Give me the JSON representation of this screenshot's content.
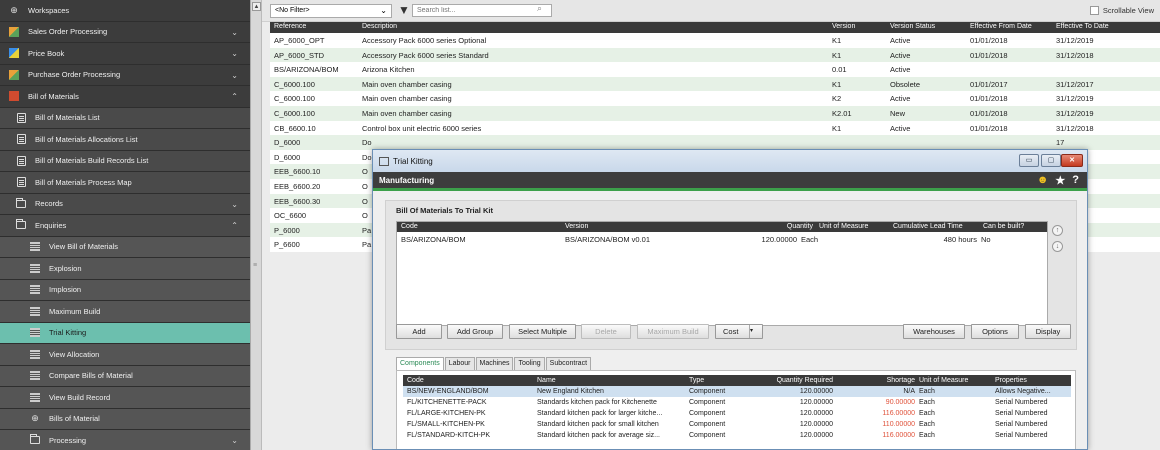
{
  "sidebar": {
    "items": [
      {
        "label": "Workspaces",
        "icon": "globe-icon",
        "level": 0,
        "chevron": ""
      },
      {
        "label": "Sales Order Processing",
        "icon": "sales-order-icon",
        "level": 0,
        "chevron": "⌄"
      },
      {
        "label": "Price Book",
        "icon": "price-book-icon",
        "level": 0,
        "chevron": "⌄"
      },
      {
        "label": "Purchase Order Processing",
        "icon": "purchase-order-icon",
        "level": 0,
        "chevron": "⌄"
      },
      {
        "label": "Bill of Materials",
        "icon": "bill-of-materials-icon",
        "level": 0,
        "chevron": "⌃"
      },
      {
        "label": "Bill of Materials List",
        "icon": "list-icon",
        "level": 1,
        "chevron": ""
      },
      {
        "label": "Bill of Materials Allocations List",
        "icon": "list-icon",
        "level": 1,
        "chevron": ""
      },
      {
        "label": "Bill of Materials Build Records List",
        "icon": "list-icon",
        "level": 1,
        "chevron": ""
      },
      {
        "label": "Bill of Materials Process Map",
        "icon": "process-map-icon",
        "level": 1,
        "chevron": ""
      },
      {
        "label": "Records",
        "icon": "folder-icon",
        "level": 1,
        "chevron": "⌄"
      },
      {
        "label": "Enquiries",
        "icon": "folder-icon",
        "level": 1,
        "chevron": "⌃"
      },
      {
        "label": "View Bill of Materials",
        "icon": "enquiry-icon",
        "level": 2,
        "chevron": ""
      },
      {
        "label": "Explosion",
        "icon": "enquiry-icon",
        "level": 2,
        "chevron": ""
      },
      {
        "label": "Implosion",
        "icon": "enquiry-icon",
        "level": 2,
        "chevron": ""
      },
      {
        "label": "Maximum Build",
        "icon": "enquiry-icon",
        "level": 2,
        "chevron": ""
      },
      {
        "label": "Trial Kitting",
        "icon": "enquiry-icon",
        "level": 2,
        "chevron": "",
        "active": true
      },
      {
        "label": "View Allocation",
        "icon": "enquiry-icon",
        "level": 2,
        "chevron": ""
      },
      {
        "label": "Compare Bills of Material",
        "icon": "enquiry-icon",
        "level": 2,
        "chevron": ""
      },
      {
        "label": "View Build Record",
        "icon": "enquiry-icon",
        "level": 2,
        "chevron": ""
      },
      {
        "label": "Bills of Material",
        "icon": "globe-icon",
        "level": 2,
        "chevron": ""
      },
      {
        "label": "Processing",
        "icon": "folder-icon",
        "level": 2,
        "chevron": "⌄"
      }
    ]
  },
  "toolbar": {
    "filter_value": "<No Filter>",
    "search_placeholder": "Search list...",
    "scrollable_view_label": "Scrollable View"
  },
  "list": {
    "headers": [
      "Reference",
      "Description",
      "Version",
      "Version Status",
      "Effective From Date",
      "Effective To Date"
    ],
    "rows": [
      [
        "AP_6000_OPT",
        "Accessory Pack 6000 series Optional",
        "K1",
        "Active",
        "01/01/2018",
        "31/12/2019"
      ],
      [
        "AP_6000_STD",
        "Accessory Pack 6000 series Standard",
        "K1",
        "Active",
        "01/01/2018",
        "31/12/2018"
      ],
      [
        "BS/ARIZONA/BOM",
        "Arizona Kitchen",
        "0.01",
        "Active",
        "",
        ""
      ],
      [
        "C_6000.100",
        "Main oven chamber casing",
        "K1",
        "Obsolete",
        "01/01/2017",
        "31/12/2017"
      ],
      [
        "C_6000.100",
        "Main oven chamber casing",
        "K2",
        "Active",
        "01/01/2018",
        "31/12/2019"
      ],
      [
        "C_6000.100",
        "Main oven chamber casing",
        "K2.01",
        "New",
        "01/01/2018",
        "31/12/2019"
      ],
      [
        "CB_6600.10",
        "Control box unit electric 6000 series",
        "K1",
        "Active",
        "01/01/2018",
        "31/12/2018"
      ],
      [
        "D_6000",
        "Do",
        "",
        "",
        "",
        "17"
      ],
      [
        "D_6000",
        "Do",
        "",
        "",
        "",
        "19"
      ],
      [
        "EEB_6600.10",
        "O",
        "",
        "",
        "",
        "18"
      ],
      [
        "EEB_6600.20",
        "O",
        "",
        "",
        "",
        "18"
      ],
      [
        "EEB_6600.30",
        "O",
        "",
        "",
        "",
        "18"
      ],
      [
        "OC_6600",
        "O",
        "",
        "",
        "",
        "18"
      ],
      [
        "P_6000",
        "Pa",
        "",
        "",
        "",
        "18"
      ],
      [
        "P_6600",
        "Pa",
        "",
        "",
        "",
        "18"
      ]
    ]
  },
  "dialog": {
    "title": "Trial Kitting",
    "min_label": "▭",
    "max_label": "▢",
    "close_label": "✕",
    "header": "Manufacturing",
    "smiley": "☻",
    "star": "★",
    "help": "?",
    "bom_title": "Bill Of Materials To Trial Kit",
    "bom_headers": [
      "Code",
      "Version",
      "Quantity",
      "Unit of Measure",
      "Cumulative Lead Time",
      "Can be built?"
    ],
    "bom_row": {
      "code": "BS/ARIZONA/BOM",
      "version": "BS/ARIZONA/BOM v0.01",
      "quantity": "120.00000",
      "uom": "Each",
      "lead_time": "480 hours",
      "can_build": "No"
    },
    "move_up": "↑",
    "move_down": "↓",
    "buttons": {
      "add": "Add",
      "add_group": "Add Group",
      "select_multiple": "Select Multiple",
      "delete": "Delete",
      "maximum_build": "Maximum Build",
      "cost": "Cost",
      "cost_arrow": "▾",
      "warehouses": "Warehouses",
      "options": "Options",
      "display": "Display"
    },
    "tabs": [
      "Components",
      "Labour",
      "Machines",
      "Tooling",
      "Subcontract"
    ],
    "comp_headers": [
      "Code",
      "Name",
      "Type",
      "Quantity Required",
      "Shortage",
      "Unit of Measure",
      "Properties"
    ],
    "comp_rows": [
      {
        "code": "BS/NEW-ENGLAND/BOM",
        "name": "New England Kitchen",
        "type": "Component",
        "qty": "120.00000",
        "shortage": "N/A",
        "uom": "Each",
        "props": "Allows Negative...",
        "sel": true,
        "red": false
      },
      {
        "code": "FL/KITCHENETTE-PACK",
        "name": "Standards kitchen pack for Kitchenette",
        "type": "Component",
        "qty": "120.00000",
        "shortage": "90.00000",
        "uom": "Each",
        "props": "Serial Numbered",
        "sel": false,
        "red": true
      },
      {
        "code": "FL/LARGE-KITCHEN-PK",
        "name": "Standard kitchen pack for larger kitche...",
        "type": "Component",
        "qty": "120.00000",
        "shortage": "116.00000",
        "uom": "Each",
        "props": "Serial Numbered",
        "sel": false,
        "red": true
      },
      {
        "code": "FL/SMALL-KITCHEN-PK",
        "name": "Standard kitchen pack for small kitchen",
        "type": "Component",
        "qty": "120.00000",
        "shortage": "110.00000",
        "uom": "Each",
        "props": "Serial Numbered",
        "sel": false,
        "red": true
      },
      {
        "code": "FL/STANDARD-KITCH-PK",
        "name": "Standard kitchen pack for average siz...",
        "type": "Component",
        "qty": "120.00000",
        "shortage": "116.00000",
        "uom": "Each",
        "props": "Serial Numbered",
        "sel": false,
        "red": true
      }
    ]
  },
  "colors": {
    "active_nav": "#6cbfae",
    "accent_green": "#3ca04a",
    "shortage_red": "#e0523a"
  }
}
